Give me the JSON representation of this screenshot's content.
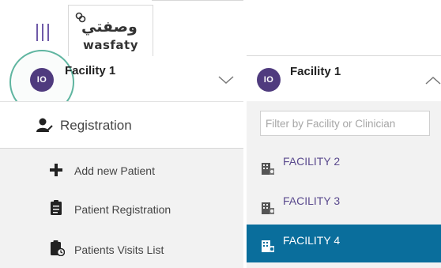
{
  "header": {
    "menu_icon": "hamburger-icon",
    "logo_arabic": "وصفتي",
    "logo_latin": "wasfaty"
  },
  "left_panel": {
    "avatar_initials": "IO",
    "facility_name": "Facility 1",
    "chevron_icon": "chevron-down-icon",
    "registration": {
      "label": "Registration",
      "icon": "user-edit-icon"
    },
    "menu_items": [
      {
        "label": "Add new Patient",
        "icon": "plus-icon"
      },
      {
        "label": "Patient Registration",
        "icon": "clipboard-icon"
      },
      {
        "label": "Patients Visits List",
        "icon": "clipboard-clock-icon"
      }
    ]
  },
  "right_panel": {
    "avatar_initials": "IO",
    "facility_name": "Facility 1",
    "chevron_icon": "chevron-up-icon",
    "filter": {
      "placeholder": "Filter by Facility or Clinician",
      "value": ""
    },
    "facilities": [
      {
        "label": "FACILITY 2",
        "selected": false,
        "icon": "building-icon"
      },
      {
        "label": "FACILITY 3",
        "selected": false,
        "icon": "building-icon"
      },
      {
        "label": "FACILITY 4",
        "selected": true,
        "icon": "building-icon"
      }
    ]
  },
  "colors": {
    "brand_purple": "#4f3b7e",
    "selected_blue": "#0a6e9c",
    "highlight_green": "#5fb5a0"
  }
}
